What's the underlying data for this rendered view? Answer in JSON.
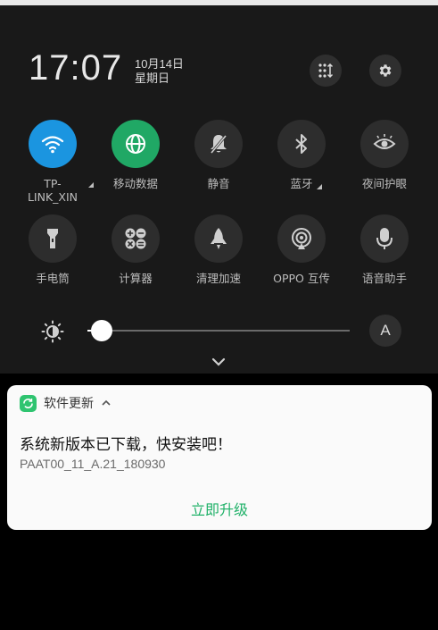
{
  "header": {
    "time": "17:07",
    "date": "10月14日",
    "weekday": "星期日"
  },
  "tiles_row1": [
    {
      "label": "TP-\nLINK_XIN",
      "icon": "wifi-icon",
      "active": true,
      "color": "#1b95e0"
    },
    {
      "label": "移动数据",
      "icon": "globe-icon",
      "active": true,
      "color": "#20a865"
    },
    {
      "label": "静音",
      "icon": "bell-off-icon",
      "active": false
    },
    {
      "label": "蓝牙",
      "icon": "bluetooth-icon",
      "active": false
    },
    {
      "label": "夜间护眼",
      "icon": "eye-icon",
      "active": false
    }
  ],
  "tiles_row2": [
    {
      "label": "手电筒",
      "icon": "flashlight-icon",
      "active": false
    },
    {
      "label": "计算器",
      "icon": "calculator-icon",
      "active": false
    },
    {
      "label": "清理加速",
      "icon": "rocket-icon",
      "active": false
    },
    {
      "label": "OPPO 互传",
      "icon": "share-icon",
      "active": false
    },
    {
      "label": "语音助手",
      "icon": "microphone-icon",
      "active": false
    }
  ],
  "brightness": {
    "level": 0.05,
    "auto_label": "A"
  },
  "notification": {
    "app_name": "软件更新",
    "title": "系统新版本已下载，快安装吧！",
    "subtitle": "PAAT00_11_A.21_180930",
    "action": "立即升级"
  }
}
